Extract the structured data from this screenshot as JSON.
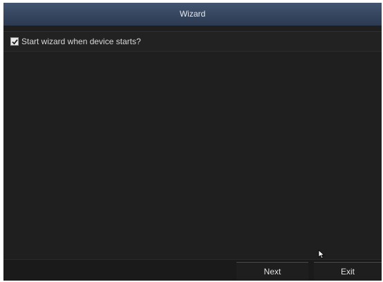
{
  "window": {
    "title": "Wizard"
  },
  "options": {
    "start_wizard_label": "Start wizard when device starts?",
    "start_wizard_checked": true
  },
  "buttons": {
    "next_label": "Next",
    "exit_label": "Exit"
  },
  "icons": {
    "checkbox": "checkmark-icon",
    "pointer": "mouse-pointer-icon"
  },
  "colors": {
    "title_bar": "#34445e",
    "background": "#1f1f1f"
  }
}
